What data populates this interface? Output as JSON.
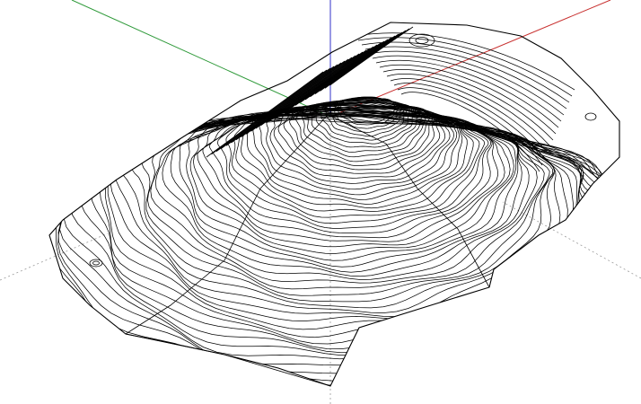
{
  "viewport": {
    "type": "3d-modeling-viewport",
    "background": "#ffffff",
    "model": "terrain-contour-mesh"
  },
  "axes": {
    "x": {
      "color": "#c8302f"
    },
    "y": {
      "color": "#2f9a3a"
    },
    "z": {
      "color": "#3030c8"
    },
    "dotted_color": "#9a9a9a"
  },
  "model": {
    "stroke_color": "#000000",
    "contour_count": 60
  }
}
